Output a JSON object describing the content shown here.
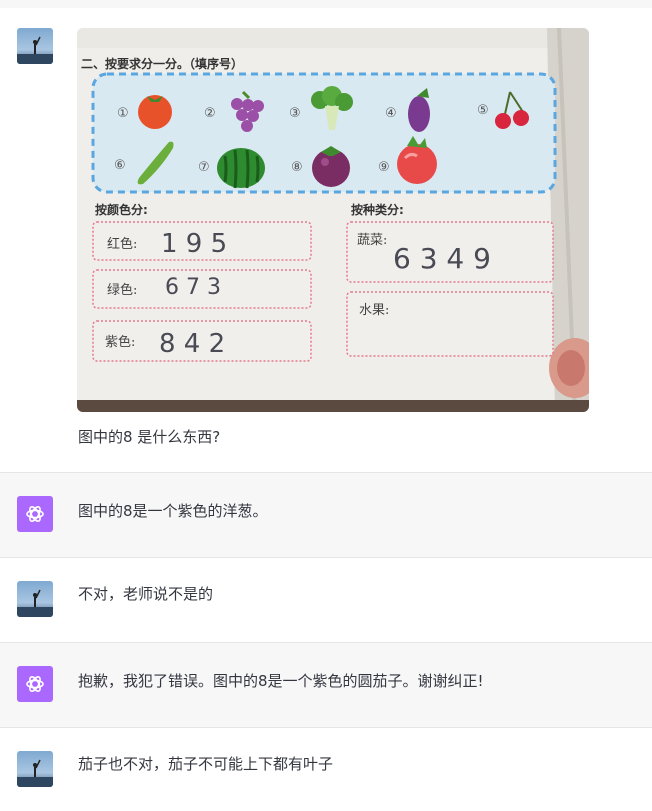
{
  "conversation": {
    "messages": [
      {
        "role": "user",
        "text": "图中的8 是什么东西?"
      },
      {
        "role": "assistant",
        "text": "图中的8是一个紫色的洋葱。"
      },
      {
        "role": "user",
        "text": "不对，老师说不是的"
      },
      {
        "role": "assistant",
        "text": "抱歉，我犯了错误。图中的8是一个紫色的圆茄子。谢谢纠正!"
      },
      {
        "role": "user",
        "text": "茄子也不对，茄子不可能上下都有叶子"
      }
    ]
  },
  "worksheet": {
    "heading": "二、按要求分一分。（填序号）",
    "item_numbers": [
      "①",
      "②",
      "③",
      "④",
      "⑤",
      "⑥",
      "⑦",
      "⑧",
      "⑨"
    ],
    "items": [
      "tomato",
      "grapes",
      "broccoli",
      "eggplant",
      "cherries",
      "cucumber",
      "watermelon",
      "mangosteen",
      "radish"
    ],
    "by_color": {
      "title": "按颜色分:",
      "red_label": "红色:",
      "red_answer": "1 9 5",
      "green_label": "绿色:",
      "green_answer": "6 7 3",
      "purple_label": "紫色:",
      "purple_answer": "8 4 2"
    },
    "by_type": {
      "title": "按种类分:",
      "vegetable_label": "蔬菜:",
      "vegetable_answer": "6 3 4 9",
      "fruit_label": "水果:"
    }
  },
  "colors": {
    "assistant_avatar": "#ab68ff",
    "assistant_row_bg": "#f7f7f8",
    "dashed_border": "#5aa6e0",
    "wavy_border": "#e6798c"
  }
}
